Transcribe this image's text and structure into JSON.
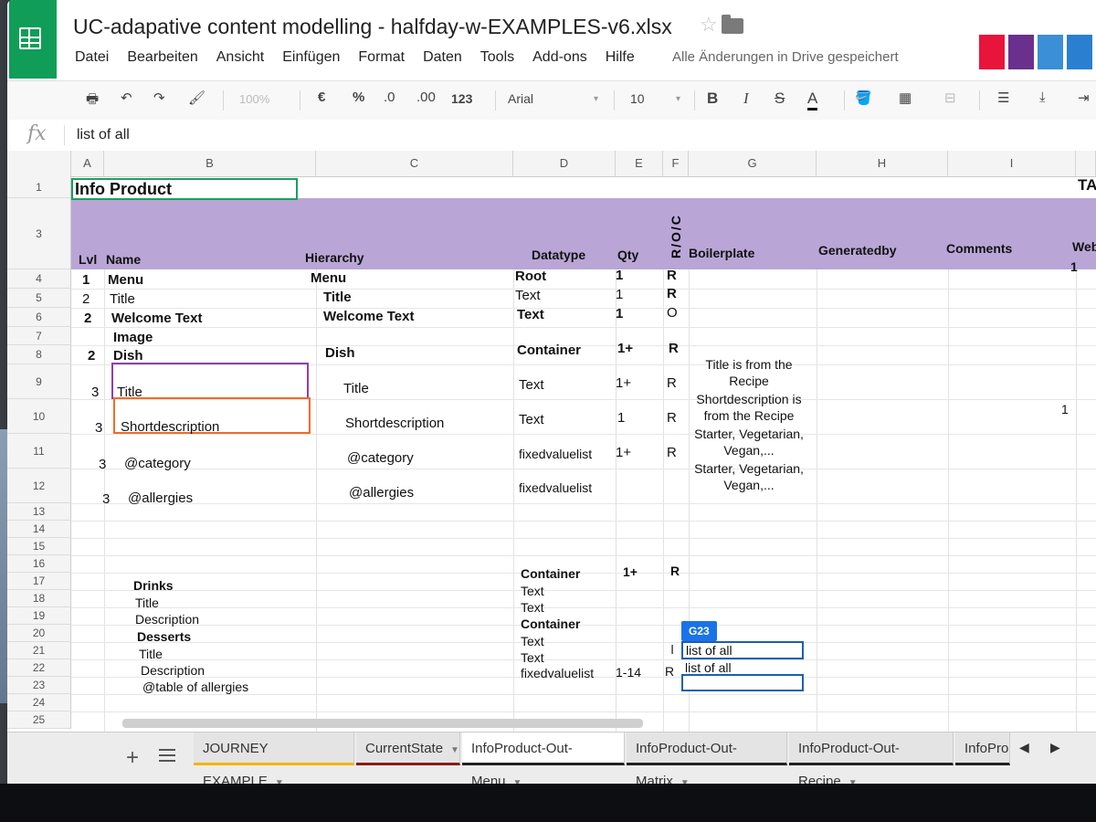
{
  "document": {
    "title": "UC-adapative content modelling - halfday-w-EXAMPLES-v6.xlsx",
    "save_status": "Alle Änderungen in Drive gespeichert"
  },
  "menu": [
    "Datei",
    "Bearbeiten",
    "Ansicht",
    "Einfügen",
    "Format",
    "Daten",
    "Tools",
    "Add-ons",
    "Hilfe"
  ],
  "toolbar": {
    "zoom": "100%",
    "currency": "€",
    "percent": "%",
    "decimal_decrease": ".0",
    "decimal_increase": ".00",
    "number_format": "123",
    "font": "Arial",
    "font_size": "10",
    "bold": "B",
    "italic": "I",
    "strike": "S",
    "text_color": "A"
  },
  "formula_bar": {
    "fx": "fx",
    "value": "list of all"
  },
  "columns": [
    "A",
    "B",
    "C",
    "D",
    "E",
    "F",
    "G",
    "H",
    "I"
  ],
  "row_numbers": [
    "1",
    "3",
    "4",
    "5",
    "6",
    "7",
    "8",
    "9",
    "10",
    "11",
    "12",
    "13",
    "14",
    "15",
    "16",
    "17",
    "18",
    "19",
    "20",
    "21",
    "22",
    "23",
    "24",
    "25"
  ],
  "title_cell": "Info Product",
  "title_right": "TA",
  "header": {
    "lvl": "Lvl",
    "name": "Name",
    "hierarchy": "Hierarchy",
    "datatype": "Datatype",
    "qty": "Qty",
    "roc": "R/O/C",
    "boilerplate": "Boilerplate",
    "generatedby": "Generatedby",
    "comments": "Comments",
    "web": "Web"
  },
  "rows": {
    "r4": {
      "lvl": "1",
      "name": "Menu",
      "hierarchy": "Menu",
      "datatype": "Root",
      "qty": "1",
      "roc": "R",
      "web": "1"
    },
    "r5": {
      "lvl": "2",
      "name": "Title",
      "hierarchy": "Title",
      "datatype": "Text",
      "qty": "1",
      "roc": "R"
    },
    "r6": {
      "lvl": "2",
      "name": "Welcome Text",
      "hierarchy": "Welcome Text",
      "datatype": "Text",
      "qty": "1",
      "roc": "O"
    },
    "r7": {
      "name": "Image"
    },
    "r8": {
      "lvl": "2",
      "name": "Dish",
      "hierarchy": "Dish",
      "datatype": "Container",
      "qty": "1+",
      "roc": "R"
    },
    "r9": {
      "lvl": "3",
      "name": "Title",
      "hierarchy": "Title",
      "datatype": "Text",
      "qty": "1+",
      "roc": "R",
      "boilerplate": "Title is from the Recipe"
    },
    "r10": {
      "lvl": "3",
      "name": "Shortdescription",
      "hierarchy": "Shortdescription",
      "datatype": "Text",
      "qty": "1",
      "roc": "R",
      "boilerplate": "Shortdescription is from the Recipe",
      "web": "1"
    },
    "r11": {
      "lvl": "3",
      "name": "@category",
      "hierarchy": "@category",
      "datatype": "fixedvaluelist",
      "qty": "1+",
      "roc": "R",
      "boilerplate": "Starter, Vegetarian, Vegan,..."
    },
    "r12": {
      "lvl": "3",
      "name": "@allergies",
      "hierarchy": "@allergies",
      "datatype": "fixedvaluelist",
      "boilerplate": "Starter, Vegetarian, Vegan,..."
    },
    "r16": {
      "datatype": "Container",
      "qty": "1+",
      "roc": "R"
    },
    "r17": {
      "name": "Drinks",
      "datatype": "Text"
    },
    "r18": {
      "name": "Title",
      "datatype": "Text"
    },
    "r19": {
      "name": "Description",
      "datatype": "Container"
    },
    "r20": {
      "name": "Desserts",
      "datatype": "Text"
    },
    "r21": {
      "name": "Title",
      "datatype": "Text",
      "boilerplate": "list of all"
    },
    "r22": {
      "name": "Description",
      "datatype": "fixedvaluelist",
      "qty": "1-14",
      "roc": "R",
      "boilerplate": "list of all"
    },
    "r23": {
      "name": "@table of allergies"
    }
  },
  "active_cell_ref": "G23",
  "sheet_tabs": [
    "JOURNEY EXAMPLE",
    "CurrentState",
    "InfoProduct-Out-Menu",
    "InfoProduct-Out-Matrix",
    "InfoProduct-Out-Recipe",
    "InfoProd"
  ],
  "sheet_tab_colors": [
    "#f4b400",
    "#8b1a1a",
    "#222222",
    "#222222",
    "#222222",
    "#222222"
  ],
  "colors": {
    "header_band": "#b9a6d6",
    "sheets_green": "#0f9d58",
    "selection_blue": "#1a73e8"
  }
}
